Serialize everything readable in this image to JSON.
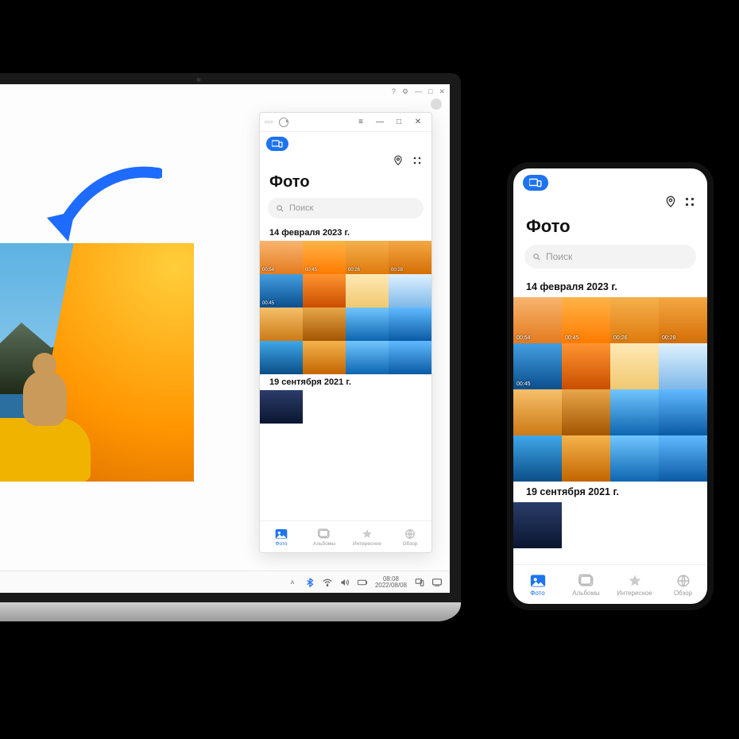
{
  "laptop": {
    "win_help": "?",
    "taskbar": {
      "time": "08:08",
      "date": "2022/08/08"
    }
  },
  "gallery": {
    "title": "Фото",
    "search_placeholder": "Поиск",
    "section1": "14 февраля 2023 г.",
    "section2": "19 сентября 2021 г.",
    "durations": {
      "d1": "00:54",
      "d2": "00:45",
      "d3": "00:26",
      "d4": "00:28",
      "d5": "00:45"
    },
    "tabs": {
      "photo": "Фото",
      "albums": "Альбомы",
      "featured": "Интересное",
      "browse": "Обзор"
    }
  }
}
